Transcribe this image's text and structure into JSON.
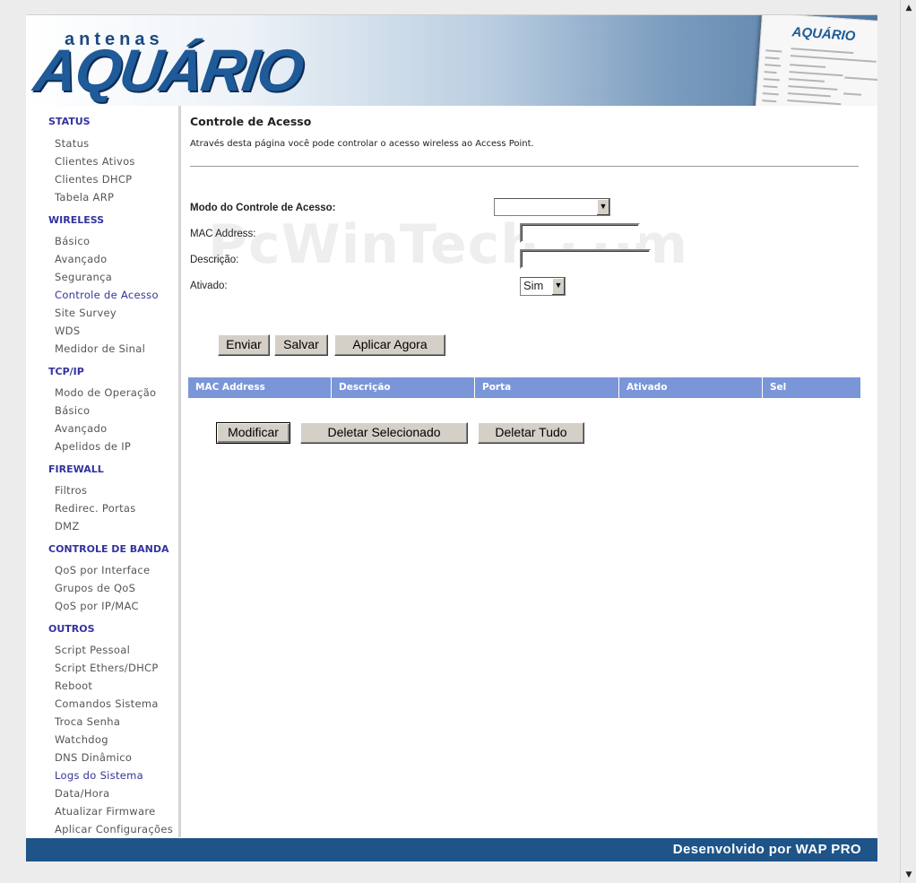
{
  "header": {
    "brand_small": "antenas",
    "brand_large": "AQUÁRIO",
    "screenshot_logo": "AQUÁRIO"
  },
  "sidebar": {
    "sections": [
      {
        "title": "STATUS",
        "items": [
          "Status",
          "Clientes Ativos",
          "Clientes DHCP",
          "Tabela ARP"
        ]
      },
      {
        "title": "WIRELESS",
        "items": [
          "Básico",
          "Avançado",
          "Segurança",
          "Controle de Acesso",
          "Site Survey",
          "WDS",
          "Medidor de Sinal"
        ]
      },
      {
        "title": "TCP/IP",
        "items": [
          "Modo de Operação",
          "Básico",
          "Avançado",
          "Apelidos de IP"
        ]
      },
      {
        "title": "FIREWALL",
        "items": [
          "Filtros",
          "Redirec. Portas",
          "DMZ"
        ]
      },
      {
        "title": "CONTROLE DE BANDA",
        "items": [
          "QoS por Interface",
          "Grupos de QoS",
          "QoS por IP/MAC"
        ]
      },
      {
        "title": "OUTROS",
        "items": [
          "Script Pessoal",
          "Script Ethers/DHCP",
          "Reboot",
          "Comandos Sistema",
          "Troca Senha",
          "Watchdog",
          "DNS Dinâmico",
          "Logs do Sistema",
          "Data/Hora",
          "Atualizar Firmware",
          "Aplicar Configurações"
        ]
      }
    ],
    "highlight_color": "#34349a"
  },
  "main": {
    "title": "Controle de Acesso",
    "description": "Através desta página você pode controlar o acesso wireless ao Access Point.",
    "form": {
      "mode_label": "Modo do Controle de Acesso:",
      "mode_value": "",
      "mac_label": "MAC Address:",
      "mac_value": "",
      "desc_label": "Descrição:",
      "desc_value": "",
      "enabled_label": "Ativado:",
      "enabled_value": "Sim"
    },
    "buttons": {
      "send": "Enviar",
      "save": "Salvar",
      "apply": "Aplicar Agora"
    },
    "table": {
      "headers": [
        "MAC Address",
        "Descrição",
        "Porta",
        "Ativado",
        "Sel"
      ],
      "header_color": "#7b96d8"
    },
    "table_buttons": {
      "modify": "Modificar",
      "delete_selected": "Deletar Selecionado",
      "delete_all": "Deletar Tudo"
    },
    "watermark": "PcWinTech.com"
  },
  "footer": {
    "text": "Desenvolvido por WAP PRO",
    "color": "#1e5488"
  }
}
